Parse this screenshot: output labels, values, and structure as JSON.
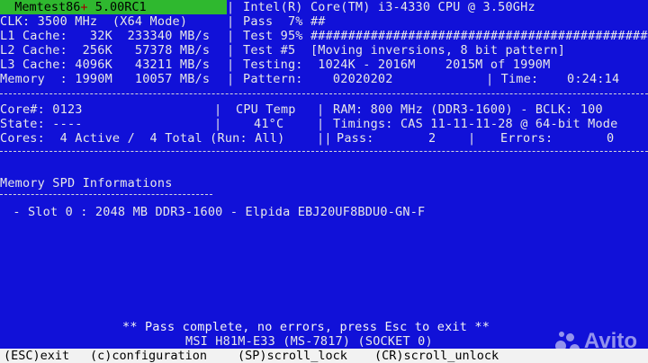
{
  "header": {
    "brand": "Memtest86",
    "plus": "+",
    "version": "5.00RC1",
    "cpu": "Intel(R) Core(TM) i3-4330 CPU @ 3.50GHz"
  },
  "left_info": {
    "clk": "CLK: 3500 MHz  (X64 Mode)",
    "l1": "L1 Cache:   32K  233340 MB/s",
    "l2": "L2 Cache:  256K   57378 MB/s",
    "l3": "L3 Cache: 4096K   43211 MB/s",
    "memory": "Memory  : 1990M   10057 MB/s"
  },
  "right_info": {
    "pass": "Pass  7% ##",
    "test": "Test 95% ################################################",
    "test_num": "Test #5  [Moving inversions, 8 bit pattern]",
    "testing": "Testing:  1024K - 2016M    2015M of 1990M",
    "pattern": "Pattern:    02020202",
    "time_label": "| Time:",
    "time_value": "0:24:14"
  },
  "status": {
    "core": "Core#: 0123",
    "state": "State: ----",
    "cores": "Cores:  4 Active /  4 Total (Run: All)",
    "cpu_temp_label": "CPU Temp",
    "cpu_temp_value": "41°C",
    "ram": "RAM: 800 MHz (DDR3-1600) - BCLK: 100",
    "timings": "Timings: CAS 11-11-11-28 @ 64-bit Mode",
    "pass_label": "Pass:",
    "pass_value": "2",
    "errors_label": "Errors:",
    "errors_value": "0"
  },
  "spd": {
    "title": "Memory SPD Informations",
    "slot": " - Slot 0 : 2048 MB DDR3-1600 - Elpida EBJ20UF8BDU0-GN-F"
  },
  "footer": {
    "message": "** Pass complete, no errors, press Esc to exit **",
    "board": "MSI H81M-E33 (MS-7817) (SOCKET 0)"
  },
  "bottom_bar": {
    "exit": "(ESC)exit",
    "config": "(c)configuration",
    "scroll_lock": "(SP)scroll_lock",
    "scroll_unlock": "(CR)scroll_unlock"
  },
  "watermark": {
    "text": "Avito"
  },
  "colors": {
    "background": "#1111d8",
    "title_bg": "#2fb82f",
    "text": "#e8e8e8",
    "message": "#f0f000"
  }
}
